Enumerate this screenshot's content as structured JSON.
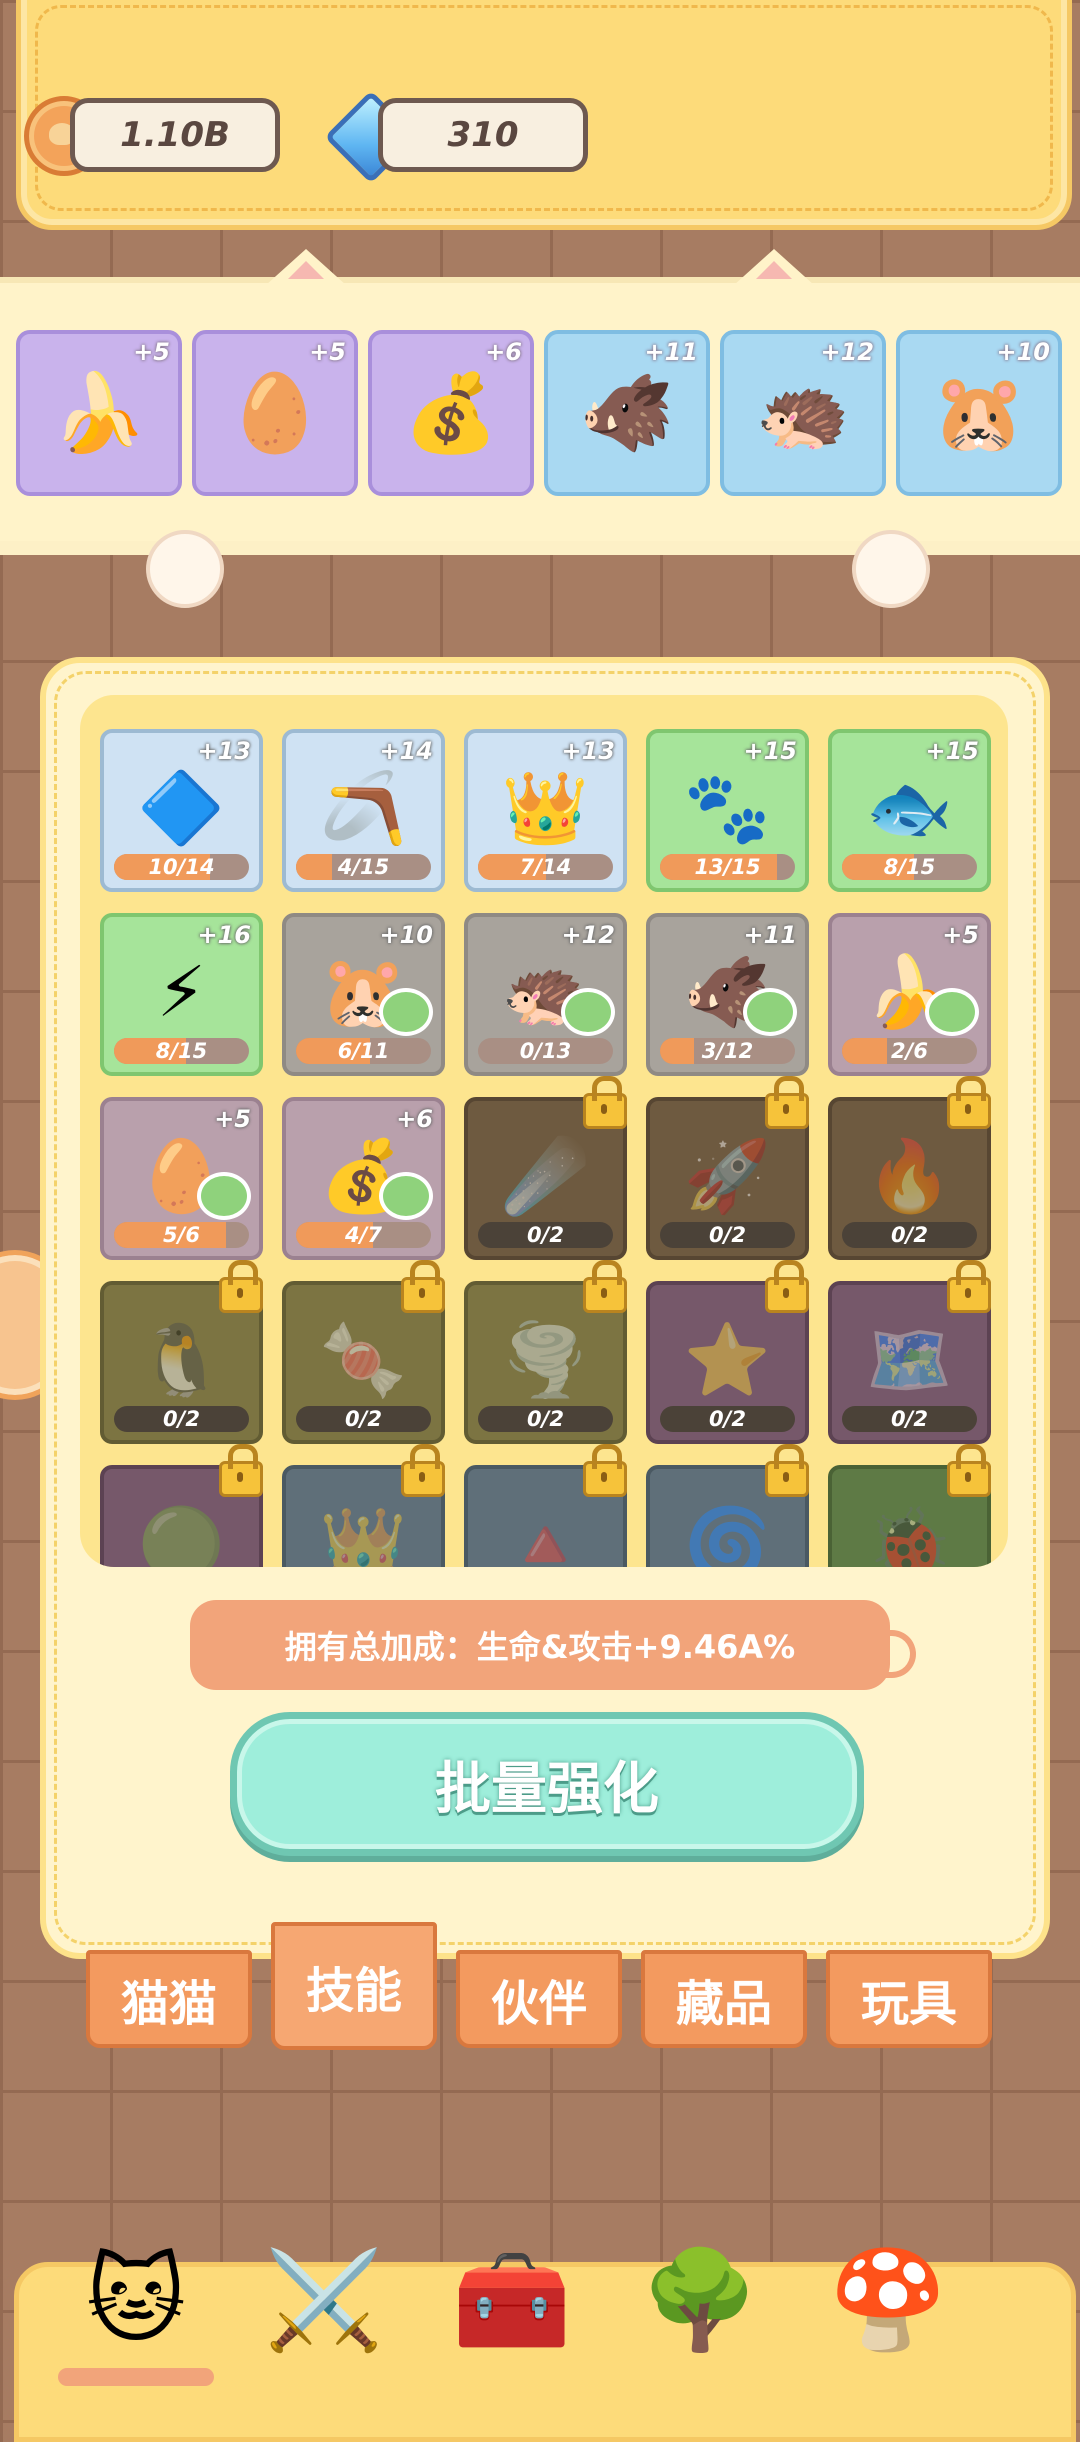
{
  "currency": {
    "coins": "1.10B",
    "gems": "310"
  },
  "equipped": [
    {
      "name": "banana",
      "level": "+5",
      "tone": "purple",
      "glyph": "🍌"
    },
    {
      "name": "egg",
      "level": "+5",
      "tone": "purple",
      "glyph": "🥚"
    },
    {
      "name": "sack",
      "level": "+6",
      "tone": "purple",
      "glyph": "💰"
    },
    {
      "name": "boar",
      "level": "+11",
      "tone": "blue",
      "glyph": "🐗"
    },
    {
      "name": "hedgehog",
      "level": "+12",
      "tone": "blue",
      "glyph": "🦔"
    },
    {
      "name": "mole",
      "level": "+10",
      "tone": "blue",
      "glyph": "🐹"
    }
  ],
  "items": [
    {
      "name": "diamond",
      "plus": "+13",
      "progress": "10/14",
      "fraction": 0.71,
      "tone": "blue",
      "glyph": "🔷",
      "paw": false,
      "locked": false
    },
    {
      "name": "boomerang",
      "plus": "+14",
      "progress": "4/15",
      "fraction": 0.27,
      "tone": "blue",
      "glyph": "🪃",
      "paw": false,
      "locked": false
    },
    {
      "name": "slime-king",
      "plus": "+13",
      "progress": "7/14",
      "fraction": 0.5,
      "tone": "blue",
      "glyph": "👑",
      "paw": false,
      "locked": false
    },
    {
      "name": "paw-print",
      "plus": "+15",
      "progress": "13/15",
      "fraction": 0.87,
      "tone": "green",
      "glyph": "🐾",
      "paw": false,
      "locked": false
    },
    {
      "name": "fish",
      "plus": "+15",
      "progress": "8/15",
      "fraction": 0.53,
      "tone": "green",
      "glyph": "🐟",
      "paw": false,
      "locked": false
    },
    {
      "name": "lightning",
      "plus": "+16",
      "progress": "8/15",
      "fraction": 0.53,
      "tone": "green",
      "glyph": "⚡",
      "paw": false,
      "locked": false
    },
    {
      "name": "mole",
      "plus": "+10",
      "progress": "6/11",
      "fraction": 0.55,
      "tone": "grey",
      "glyph": "🐹",
      "paw": true,
      "locked": false
    },
    {
      "name": "hedgehog",
      "plus": "+12",
      "progress": "0/13",
      "fraction": 0,
      "tone": "grey",
      "glyph": "🦔",
      "paw": true,
      "locked": false
    },
    {
      "name": "boar",
      "plus": "+11",
      "progress": "3/12",
      "fraction": 0.25,
      "tone": "grey",
      "glyph": "🐗",
      "paw": true,
      "locked": false
    },
    {
      "name": "banana",
      "plus": "+5",
      "progress": "2/6",
      "fraction": 0.33,
      "tone": "mauve",
      "glyph": "🍌",
      "paw": true,
      "locked": false
    },
    {
      "name": "egg",
      "plus": "+5",
      "progress": "5/6",
      "fraction": 0.83,
      "tone": "mauve",
      "glyph": "🥚",
      "paw": true,
      "locked": false
    },
    {
      "name": "sack",
      "plus": "+6",
      "progress": "4/7",
      "fraction": 0.57,
      "tone": "mauve",
      "glyph": "💰",
      "paw": true,
      "locked": false
    },
    {
      "name": "meteor",
      "plus": "",
      "progress": "0/2",
      "fraction": 0,
      "tone": "lockbrown",
      "glyph": "☄️",
      "paw": false,
      "locked": true
    },
    {
      "name": "rocket",
      "plus": "",
      "progress": "0/2",
      "fraction": 0,
      "tone": "lockbrown",
      "glyph": "🚀",
      "paw": false,
      "locked": true
    },
    {
      "name": "flame",
      "plus": "",
      "progress": "0/2",
      "fraction": 0,
      "tone": "lockbrown",
      "glyph": "🔥",
      "paw": false,
      "locked": true
    },
    {
      "name": "penguin",
      "plus": "",
      "progress": "0/2",
      "fraction": 0,
      "tone": "lockolive",
      "glyph": "🐧",
      "paw": false,
      "locked": true
    },
    {
      "name": "candy",
      "plus": "",
      "progress": "0/2",
      "fraction": 0,
      "tone": "lockolive",
      "glyph": "🍬",
      "paw": false,
      "locked": true
    },
    {
      "name": "tornado",
      "plus": "",
      "progress": "0/2",
      "fraction": 0,
      "tone": "lockolive",
      "glyph": "🌪️",
      "paw": false,
      "locked": true
    },
    {
      "name": "star",
      "plus": "",
      "progress": "0/2",
      "fraction": 0,
      "tone": "lockplum",
      "glyph": "⭐",
      "paw": false,
      "locked": true
    },
    {
      "name": "map",
      "plus": "",
      "progress": "0/2",
      "fraction": 0,
      "tone": "lockplum",
      "glyph": "🗺️",
      "paw": false,
      "locked": true
    },
    {
      "name": "item-21",
      "plus": "",
      "progress": "",
      "fraction": 0,
      "tone": "lockplum",
      "glyph": "🟢",
      "paw": false,
      "locked": true
    },
    {
      "name": "item-22",
      "plus": "",
      "progress": "",
      "fraction": 0,
      "tone": "lockslate",
      "glyph": "👑",
      "paw": false,
      "locked": true
    },
    {
      "name": "item-23",
      "plus": "",
      "progress": "",
      "fraction": 0,
      "tone": "lockslate",
      "glyph": "🔺",
      "paw": false,
      "locked": true
    },
    {
      "name": "item-24",
      "plus": "",
      "progress": "",
      "fraction": 0,
      "tone": "lockslate",
      "glyph": "🌀",
      "paw": false,
      "locked": true
    },
    {
      "name": "item-25",
      "plus": "",
      "progress": "",
      "fraction": 0,
      "tone": "lockgreen",
      "glyph": "🐞",
      "paw": false,
      "locked": true
    }
  ],
  "bonus_text": "拥有总加成：生命&攻击+9.46A%",
  "batch_button": "批量强化",
  "tabs": [
    {
      "label": "猫猫",
      "active": false
    },
    {
      "label": "技能",
      "active": true
    },
    {
      "label": "伙伴",
      "active": false
    },
    {
      "label": "藏品",
      "active": false
    },
    {
      "label": "玩具",
      "active": false
    }
  ],
  "bottom_nav": [
    {
      "name": "cat-home",
      "glyph": "🐱"
    },
    {
      "name": "battle",
      "glyph": "⚔️"
    },
    {
      "name": "treasure-chest",
      "glyph": "🧰"
    },
    {
      "name": "tree",
      "glyph": "🌳"
    },
    {
      "name": "mushroom-house",
      "glyph": "🍄"
    }
  ]
}
